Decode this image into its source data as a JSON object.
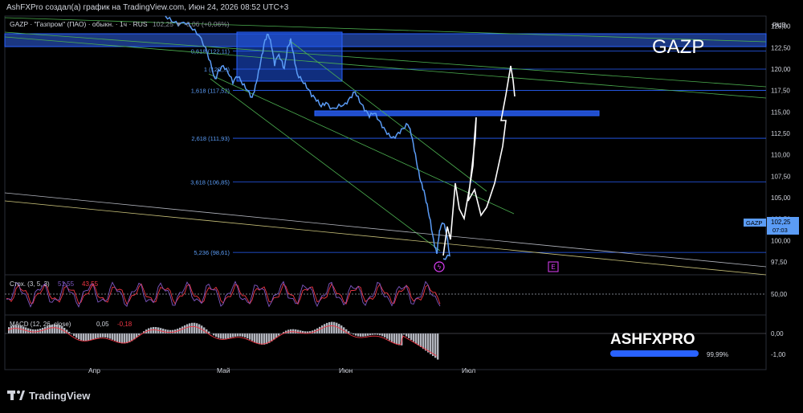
{
  "header": {
    "caption": "AshFXPro создал(а) график на TradingView.com, Июн 24, 2026 08:52 UTC+3"
  },
  "symbol": {
    "line": "GAZP · \"Газпром\" (ПАО) · обыкн. · 1ч · RUS",
    "change_text": "102,25 ▼ -0,06 (+0,06%)",
    "watermark": "GAZP",
    "currency": "RUB",
    "last_ticker": "GAZP",
    "last_price": "102,25",
    "countdown": "07:03"
  },
  "fib_levels": [
    {
      "label": "0,618 (122,11)",
      "price": 122.11
    },
    {
      "label": "1 (120,...)",
      "price": 120.0
    },
    {
      "label": "1,618 (117,52)",
      "price": 117.52
    },
    {
      "label": "2,618 (111,93)",
      "price": 111.93
    },
    {
      "label": "3,618 (106,85)",
      "price": 106.85
    },
    {
      "label": "5,236 (98,61)",
      "price": 98.61
    }
  ],
  "price_axis": {
    "ticks": [
      "125,00",
      "122,50",
      "120,00",
      "117,50",
      "115,00",
      "112,50",
      "110,00",
      "107,50",
      "105,00",
      "102,50",
      "100,00",
      "97,50"
    ],
    "min": 96,
    "max": 126
  },
  "time_axis": {
    "labels": [
      "Апр",
      "Май",
      "Июн",
      "Июл"
    ]
  },
  "stoch": {
    "label": "Стох. (3, 5, 3)",
    "k": "51,55",
    "d": "43,55",
    "level": "50,00"
  },
  "macd": {
    "label": "MACD (12, 26, close)",
    "value": "0,05",
    "signal": "-0,18",
    "ticks": [
      "0,00",
      "-1,00"
    ]
  },
  "colors": {
    "price_line": "#5b9cf6",
    "fib": "#2962ff",
    "trend": "#4caf50",
    "macd_hist": "#b2b5be",
    "stoch_k": "#7e57c2",
    "stoch_d": "#f23645",
    "zone": "#1e53e5",
    "forecast": "#ffffff"
  },
  "logo": {
    "brand": "ASHFXPRO",
    "progress_text": "99,99%",
    "progress": 0.9999
  },
  "footer": {
    "brand": "TradingView"
  },
  "events": {
    "marker_e": "E"
  }
}
